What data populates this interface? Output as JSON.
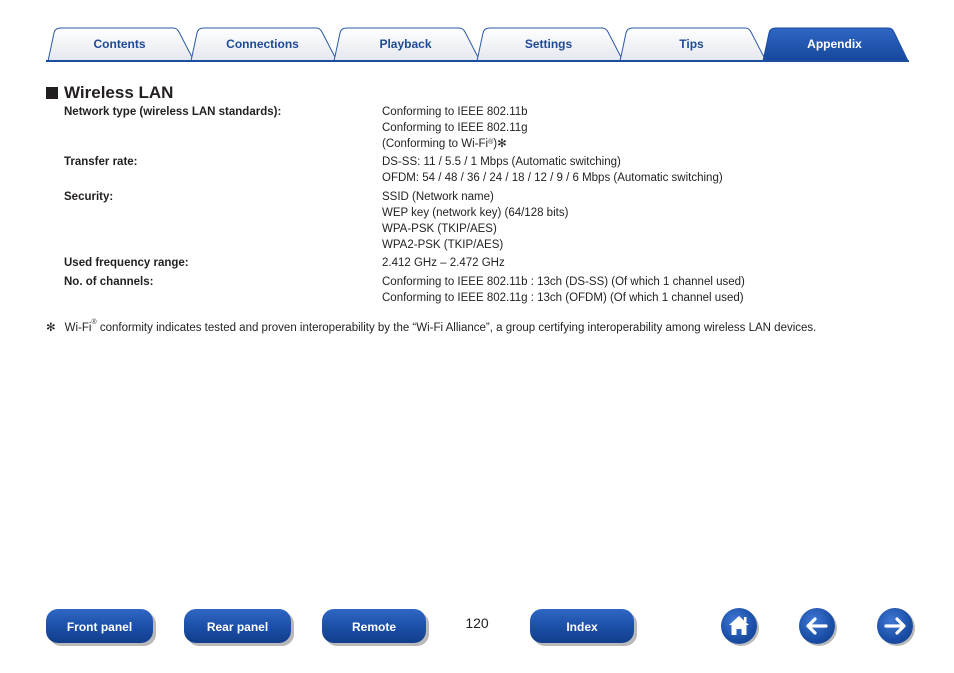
{
  "tabs": [
    {
      "label": "Contents",
      "active": false
    },
    {
      "label": "Connections",
      "active": false
    },
    {
      "label": "Playback",
      "active": false
    },
    {
      "label": "Settings",
      "active": false
    },
    {
      "label": "Tips",
      "active": false
    },
    {
      "label": "Appendix",
      "active": true
    }
  ],
  "section": {
    "title": "Wireless LAN",
    "specs": [
      {
        "label": "Network type (wireless LAN standards):",
        "values": [
          "Conforming to IEEE 802.11b",
          "Conforming to IEEE 802.11g"
        ],
        "wifi_line": {
          "prefix": "(Conforming to Wi-Fi",
          "reg": "®",
          "suffix": ")✻"
        }
      },
      {
        "label": "Transfer rate:",
        "values": [
          "DS-SS: 11 / 5.5 / 1 Mbps (Automatic switching)",
          "OFDM: 54 / 48 / 36 / 24 / 18 / 12 / 9 / 6 Mbps (Automatic switching)"
        ]
      },
      {
        "label": "Security:",
        "values": [
          "SSID (Network name)",
          "WEP key (network key) (64/128 bits)",
          "WPA-PSK (TKIP/AES)",
          "WPA2-PSK (TKIP/AES)"
        ]
      },
      {
        "label": "Used frequency range:",
        "values": [
          "2.412 GHz – 2.472 GHz"
        ]
      },
      {
        "label": "No. of channels:",
        "values": [
          "Conforming to IEEE 802.11b : 13ch (DS-SS) (Of which 1 channel used)",
          "Conforming to IEEE 802.11g : 13ch (OFDM) (Of which 1 channel used)"
        ]
      }
    ],
    "footnote": {
      "mark": "✻",
      "prefix": "Wi-Fi",
      "reg": "®",
      "text": " conformity indicates tested and proven interoperability by the “Wi-Fi Alliance”, a group certifying interoperability among wireless LAN devices."
    }
  },
  "bottom_nav": {
    "front_panel": "Front panel",
    "rear_panel": "Rear panel",
    "remote": "Remote",
    "index": "Index",
    "page_number": "120",
    "home_icon": "home-icon",
    "back_icon": "arrow-left-icon",
    "forward_icon": "arrow-right-icon"
  },
  "colors": {
    "accent": "#1a4ea0",
    "tab_text": "#1f4a96",
    "text": "#231f20"
  }
}
